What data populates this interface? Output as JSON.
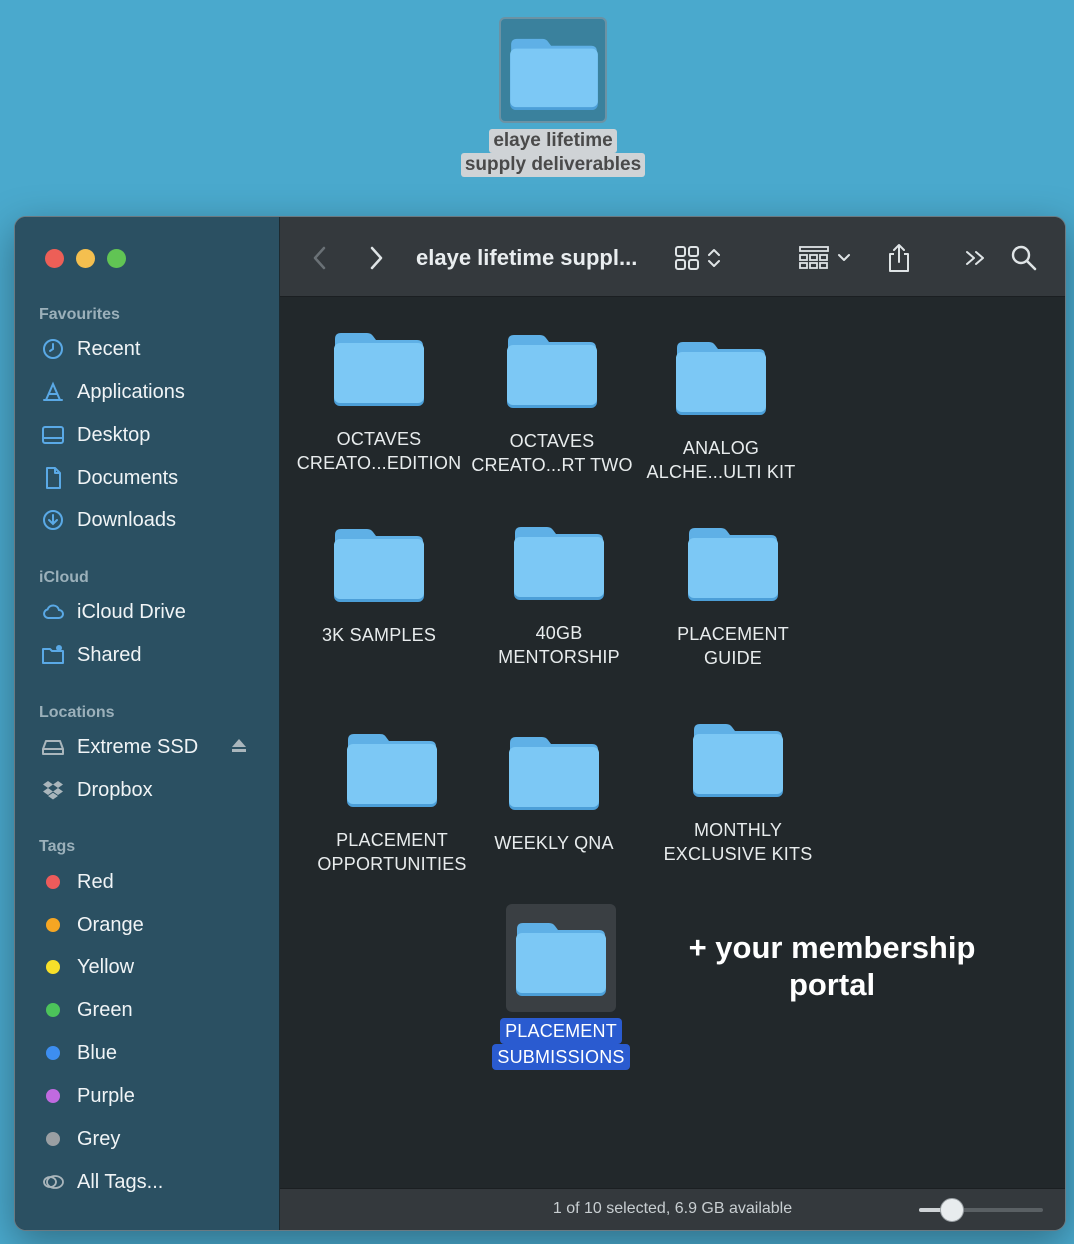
{
  "desktop": {
    "folder_label_line1": "elaye lifetime",
    "folder_label_line2": "supply deliverables"
  },
  "window": {
    "title": "elaye lifetime suppl...",
    "traffic_lights": [
      "close",
      "minimize",
      "zoom"
    ]
  },
  "toolbar": {
    "back_icon": "chevron-left-icon",
    "forward_icon": "chevron-right-icon",
    "view_icon": "icon-grid-view-icon",
    "group_icon": "group-by-icon",
    "share_icon": "share-icon",
    "more_icon": "double-chevron-icon",
    "search_icon": "search-icon"
  },
  "sidebar": {
    "favourites": {
      "heading": "Favourites",
      "items": [
        {
          "label": "Recent",
          "icon": "clock-icon"
        },
        {
          "label": "Applications",
          "icon": "applications-icon"
        },
        {
          "label": "Desktop",
          "icon": "desktop-icon"
        },
        {
          "label": "Documents",
          "icon": "document-icon"
        },
        {
          "label": "Downloads",
          "icon": "download-icon"
        }
      ]
    },
    "icloud": {
      "heading": "iCloud",
      "items": [
        {
          "label": "iCloud Drive",
          "icon": "cloud-icon"
        },
        {
          "label": "Shared",
          "icon": "shared-folder-icon"
        }
      ]
    },
    "locations": {
      "heading": "Locations",
      "items": [
        {
          "label": "Extreme SSD",
          "icon": "drive-icon"
        },
        {
          "label": "Dropbox",
          "icon": "dropbox-icon"
        }
      ]
    },
    "tags": {
      "heading": "Tags",
      "items": [
        {
          "label": "Red",
          "color": "#ec5b5b"
        },
        {
          "label": "Orange",
          "color": "#f5a623"
        },
        {
          "label": "Yellow",
          "color": "#f7e02a"
        },
        {
          "label": "Green",
          "color": "#4cc35a"
        },
        {
          "label": "Blue",
          "color": "#3d8ef0"
        },
        {
          "label": "Purple",
          "color": "#c06ae0"
        },
        {
          "label": "Grey",
          "color": "#9a9fa3"
        },
        {
          "label": "All Tags...",
          "icon": "all-tags-icon"
        }
      ]
    }
  },
  "content": {
    "items": [
      {
        "line1": "OCTAVES",
        "line2": "CREATO...EDITION"
      },
      {
        "line1": "OCTAVES",
        "line2": "CREATO...RT TWO"
      },
      {
        "line1": "ANALOG",
        "line2": "ALCHE...ULTI KIT"
      },
      {
        "line1": "3K SAMPLES",
        "line2": ""
      },
      {
        "line1": "40GB",
        "line2": "MENTORSHIP"
      },
      {
        "line1": "PLACEMENT",
        "line2": "GUIDE"
      },
      {
        "line1": "PLACEMENT",
        "line2": "OPPORTUNITIES"
      },
      {
        "line1": "WEEKLY QNA",
        "line2": ""
      },
      {
        "line1": "MONTHLY",
        "line2": "EXCLUSIVE KITS"
      },
      {
        "line1": "PLACEMENT",
        "line2": "SUBMISSIONS",
        "selected": true
      }
    ],
    "promo_line1": "+ your membership",
    "promo_line2": "portal"
  },
  "statusbar": {
    "text": "1 of 10 selected, 6.9 GB available",
    "icon_size_fraction": 0.27
  },
  "colors": {
    "folder_body": "#7cc8f5",
    "folder_tab": "#5fb0e6",
    "selection": "#2a5bd0"
  }
}
